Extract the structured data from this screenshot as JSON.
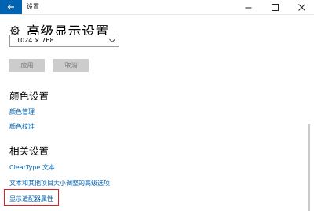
{
  "window": {
    "title": "设置",
    "back_icon": "arrow-left-icon",
    "accent": "#0063b1"
  },
  "page": {
    "title": "高级显示设置",
    "icon": "gear-icon"
  },
  "resolution": {
    "selected": "1024 × 768"
  },
  "buttons": {
    "apply": "应用",
    "cancel": "取消"
  },
  "color_section": {
    "title": "颜色设置",
    "links": [
      "颜色管理",
      "颜色校准"
    ]
  },
  "related_section": {
    "title": "相关设置",
    "links": [
      "ClearType 文本",
      "文本和其他项目大小调整的高级选项",
      "显示适配器属性"
    ]
  },
  "highlight_color": "#e02020"
}
